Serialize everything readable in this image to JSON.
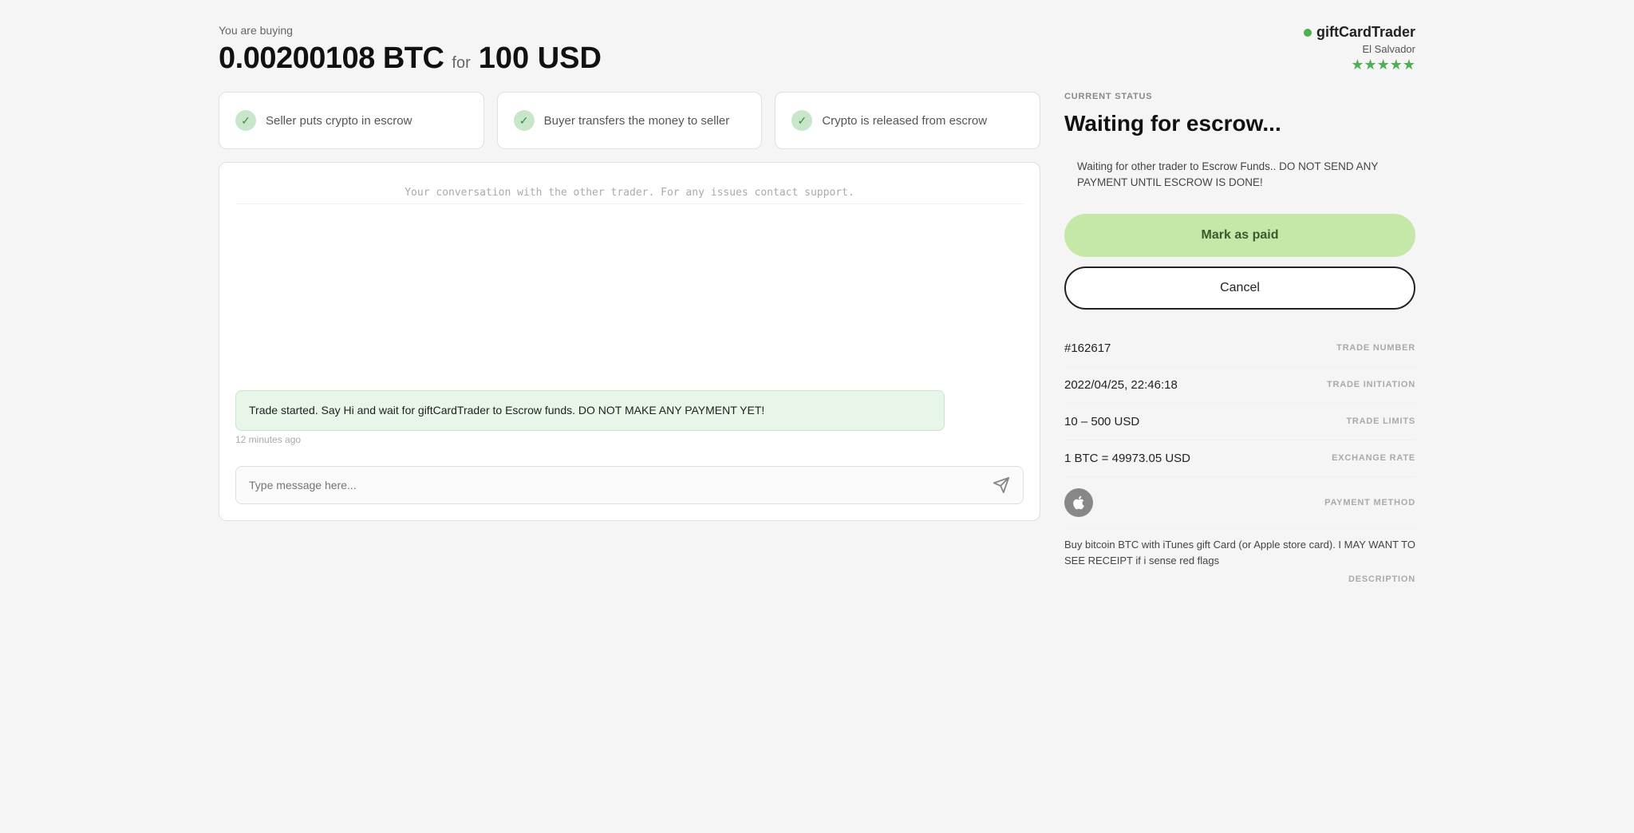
{
  "header": {
    "buying_label": "You are buying",
    "trade_amount": "0.00200108 BTC",
    "trade_for": "for",
    "trade_fiat": "100 USD"
  },
  "trader": {
    "name": "giftCardTrader",
    "location": "El Salvador",
    "stars": "★★★★★"
  },
  "steps": [
    {
      "label": "Seller puts crypto in escrow",
      "active": true
    },
    {
      "label": "Buyer transfers the money to seller",
      "active": true
    },
    {
      "label": "Crypto is released from escrow",
      "active": true
    }
  ],
  "chat": {
    "hint": "Your conversation with the other trader. For any issues contact support.",
    "message": "Trade started. Say Hi and wait for giftCardTrader to Escrow funds. DO NOT MAKE ANY PAYMENT YET!",
    "message_time": "12 minutes ago",
    "input_placeholder": "Type message here..."
  },
  "status": {
    "current_status_label": "CURRENT STATUS",
    "title": "Waiting for escrow...",
    "warning": "Waiting for other trader to Escrow Funds.. DO NOT SEND ANY PAYMENT UNTIL ESCROW IS DONE!",
    "mark_paid_label": "Mark as paid",
    "cancel_label": "Cancel"
  },
  "trade_details": {
    "trade_number_value": "#162617",
    "trade_number_label": "TRADE NUMBER",
    "trade_initiation_value": "2022/04/25, 22:46:18",
    "trade_initiation_label": "TRADE INITIATION",
    "trade_limits_value": "10 – 500 USD",
    "trade_limits_label": "TRADE LIMITS",
    "exchange_rate_value": "1 BTC = 49973.05 USD",
    "exchange_rate_label": "EXCHANGE RATE",
    "payment_method_label": "PAYMENT METHOD",
    "description_text": "Buy bitcoin BTC with iTunes gift Card (or Apple store card). I MAY WANT TO SEE RECEIPT if i sense red flags",
    "description_label": "DESCRIPTION"
  },
  "colors": {
    "green_dot": "#4caf50",
    "star_color": "#4caf50",
    "bubble_bg": "#e8f5e9",
    "mark_paid_bg": "#c5e8a8"
  }
}
